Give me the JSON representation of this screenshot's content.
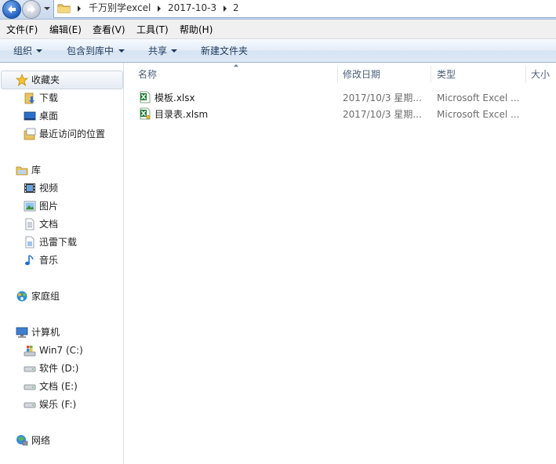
{
  "address": {
    "segments": [
      "千万别学excel",
      "2017-10-3",
      "2"
    ]
  },
  "menu": {
    "items": [
      "文件(F)",
      "编辑(E)",
      "查看(V)",
      "工具(T)",
      "帮助(H)"
    ]
  },
  "commands": {
    "organize": "组织",
    "include_in_library": "包含到库中",
    "share": "共享",
    "new_folder": "新建文件夹"
  },
  "nav": {
    "favorites": {
      "label": "收藏夹",
      "items": [
        "下载",
        "桌面",
        "最近访问的位置"
      ]
    },
    "libraries": {
      "label": "库",
      "items": [
        "视频",
        "图片",
        "文档",
        "迅雷下载",
        "音乐"
      ]
    },
    "homegroup": "家庭组",
    "computer": {
      "label": "计算机",
      "drives": [
        "Win7 (C:)",
        "软件 (D:)",
        "文档 (E:)",
        "娱乐 (F:)"
      ]
    },
    "network": "网络"
  },
  "list": {
    "columns": {
      "name": "名称",
      "modified": "修改日期",
      "type": "类型",
      "size": "大小"
    },
    "files": [
      {
        "name": "模板.xlsx",
        "modified": "2017/10/3 星期...",
        "type": "Microsoft Excel ...",
        "icon": "excel-file-icon"
      },
      {
        "name": "目录表.xlsm",
        "modified": "2017/10/3 星期...",
        "type": "Microsoft Excel ...",
        "icon": "excel-macro-file-icon"
      }
    ]
  },
  "colors": {
    "nav_text": "#1e1e1e",
    "header_text": "#4c607a",
    "meta_text": "#6d6d6d",
    "command_text": "#1e395b",
    "excel_green": "#1f7a34"
  }
}
